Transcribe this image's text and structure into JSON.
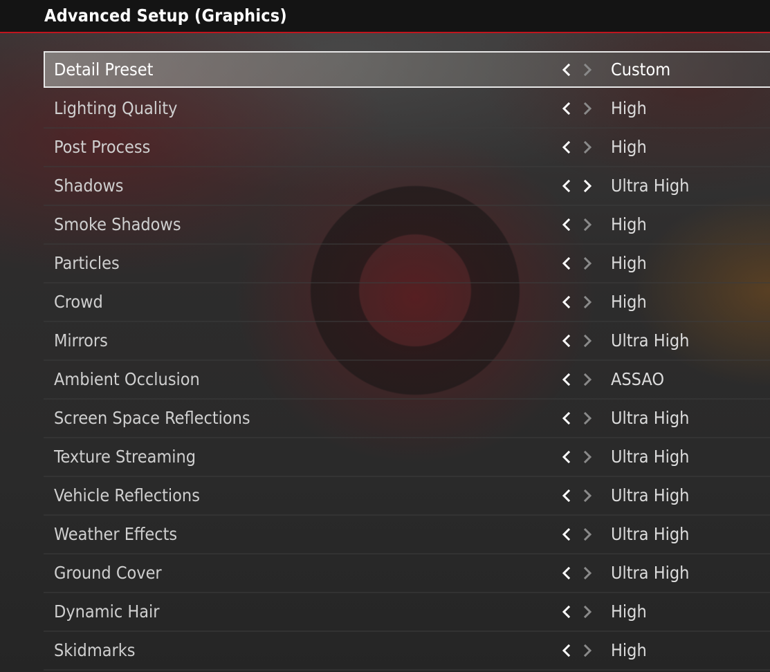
{
  "header": {
    "title": "Advanced Setup (Graphics)"
  },
  "colors": {
    "accent": "#c0151e",
    "header_bg": "#141414",
    "text": "#cfcfcf",
    "selected_text": "#ffffff"
  },
  "settings": [
    {
      "label": "Detail Preset",
      "value": "Custom",
      "selected": true,
      "right_enabled": false
    },
    {
      "label": "Lighting Quality",
      "value": "High",
      "selected": false,
      "right_enabled": false
    },
    {
      "label": "Post Process",
      "value": "High",
      "selected": false,
      "right_enabled": false
    },
    {
      "label": "Shadows",
      "value": "Ultra High",
      "selected": false,
      "right_enabled": true
    },
    {
      "label": "Smoke Shadows",
      "value": "High",
      "selected": false,
      "right_enabled": false
    },
    {
      "label": "Particles",
      "value": "High",
      "selected": false,
      "right_enabled": false
    },
    {
      "label": "Crowd",
      "value": "High",
      "selected": false,
      "right_enabled": false
    },
    {
      "label": "Mirrors",
      "value": "Ultra High",
      "selected": false,
      "right_enabled": false
    },
    {
      "label": "Ambient Occlusion",
      "value": "ASSAO",
      "selected": false,
      "right_enabled": false
    },
    {
      "label": "Screen Space Reflections",
      "value": "Ultra High",
      "selected": false,
      "right_enabled": false
    },
    {
      "label": "Texture Streaming",
      "value": "Ultra High",
      "selected": false,
      "right_enabled": false
    },
    {
      "label": "Vehicle Reflections",
      "value": "Ultra High",
      "selected": false,
      "right_enabled": false
    },
    {
      "label": "Weather Effects",
      "value": "Ultra High",
      "selected": false,
      "right_enabled": false
    },
    {
      "label": "Ground Cover",
      "value": "Ultra High",
      "selected": false,
      "right_enabled": false
    },
    {
      "label": "Dynamic Hair",
      "value": "High",
      "selected": false,
      "right_enabled": false
    },
    {
      "label": "Skidmarks",
      "value": "High",
      "selected": false,
      "right_enabled": false
    }
  ],
  "icons": {
    "prev": "chevron-left-icon",
    "next": "chevron-right-icon"
  }
}
